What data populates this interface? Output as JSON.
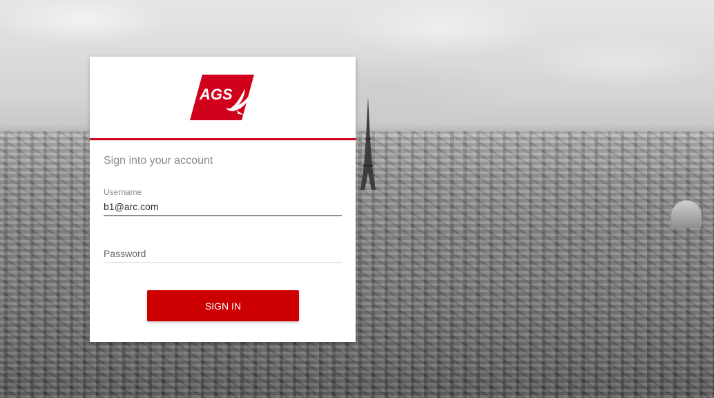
{
  "login": {
    "logo_text": "AGS",
    "heading": "Sign into your account",
    "username_label": "Username",
    "username_value": "b1@arc.com",
    "password_placeholder": "Password",
    "submit_label": "SIGN IN"
  },
  "colors": {
    "brand_red": "#d0021b",
    "button_red": "#cc0000"
  },
  "icons": {
    "logo_mark": "ags-bird-logo"
  }
}
